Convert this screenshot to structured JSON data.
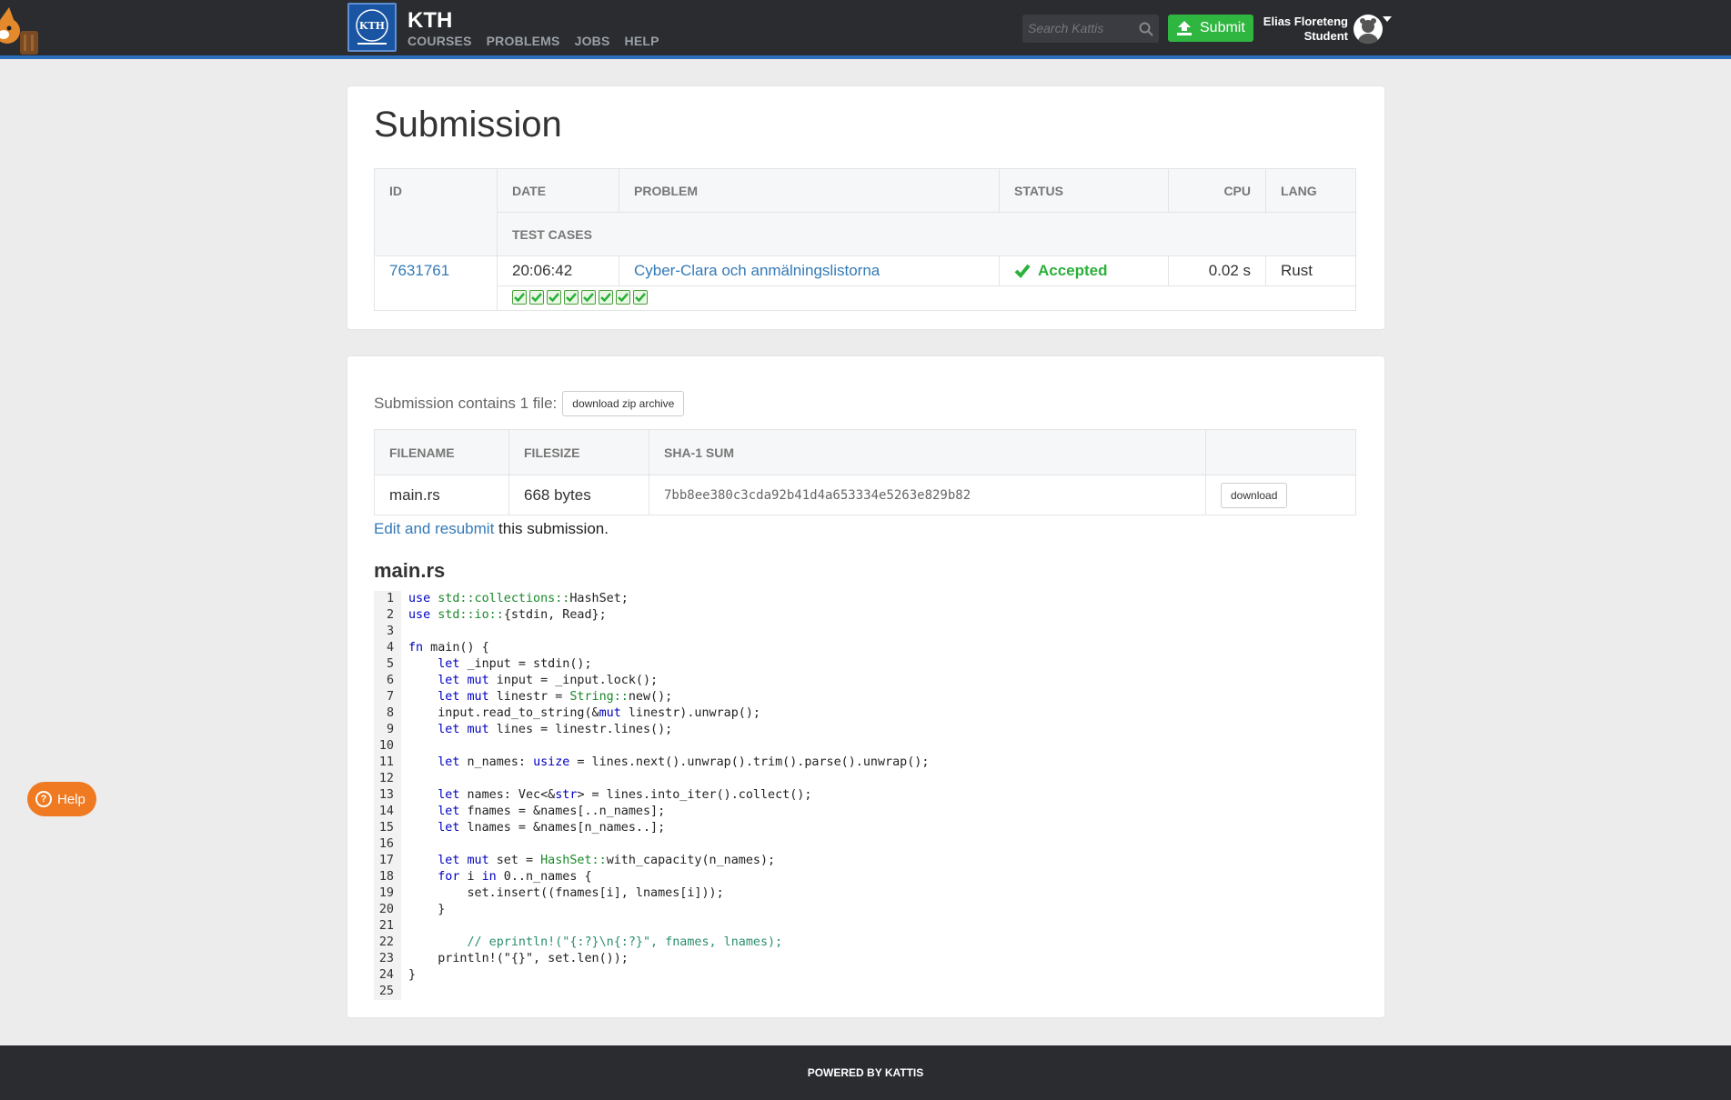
{
  "header": {
    "brand": "KTH",
    "nav": [
      "COURSES",
      "PROBLEMS",
      "JOBS",
      "HELP"
    ],
    "search_placeholder": "Search Kattis",
    "submit_label": "Submit",
    "user_name": "Elias Floreteng",
    "user_role": "Student"
  },
  "submission": {
    "title": "Submission",
    "columns": {
      "id": "ID",
      "date": "DATE",
      "problem": "PROBLEM",
      "status": "STATUS",
      "cpu": "CPU",
      "lang": "LANG",
      "test_cases": "TEST CASES"
    },
    "id": "7631761",
    "date": "20:06:42",
    "problem": "Cyber-Clara och anmälningslistorna",
    "status": "Accepted",
    "cpu": "0.02 s",
    "lang": "Rust",
    "test_cases_passed": 8
  },
  "files": {
    "contains_text": "Submission contains 1 file:",
    "zip_button": "download zip archive",
    "columns": {
      "filename": "FILENAME",
      "filesize": "FILESIZE",
      "sha1": "SHA-1 SUM"
    },
    "rows": [
      {
        "filename": "main.rs",
        "filesize": "668 bytes",
        "sha1": "7bb8ee380c3cda92b41d4a653334e5263e829b82",
        "download_label": "download"
      }
    ],
    "resubmit_link": "Edit and resubmit",
    "resubmit_rest": " this submission."
  },
  "code": {
    "filename": "main.rs",
    "lines": [
      "use std::collections::HashSet;",
      "use std::io::{stdin, Read};",
      "",
      "fn main() {",
      "    let _input = stdin();",
      "    let mut input = _input.lock();",
      "    let mut linestr = String::new();",
      "    input.read_to_string(&mut linestr).unwrap();",
      "    let mut lines = linestr.lines();",
      "",
      "    let n_names: usize = lines.next().unwrap().trim().parse().unwrap();",
      "",
      "    let names: Vec<&str> = lines.into_iter().collect();",
      "    let fnames = &names[..n_names];",
      "    let lnames = &names[n_names..];",
      "",
      "    let mut set = HashSet::with_capacity(n_names);",
      "    for i in 0..n_names {",
      "        set.insert((fnames[i], lnames[i]));",
      "    }",
      "",
      "        // eprintln!(\"{:?}\\n{:?}\", fnames, lnames);",
      "    println!(\"{}\", set.len());",
      "}",
      ""
    ]
  },
  "help_button": "Help",
  "footer": "POWERED BY KATTIS",
  "colors": {
    "accent": "#2c6fbd",
    "success": "#2bb03a",
    "help": "#ef7a22",
    "topbar": "#2a2c30"
  }
}
